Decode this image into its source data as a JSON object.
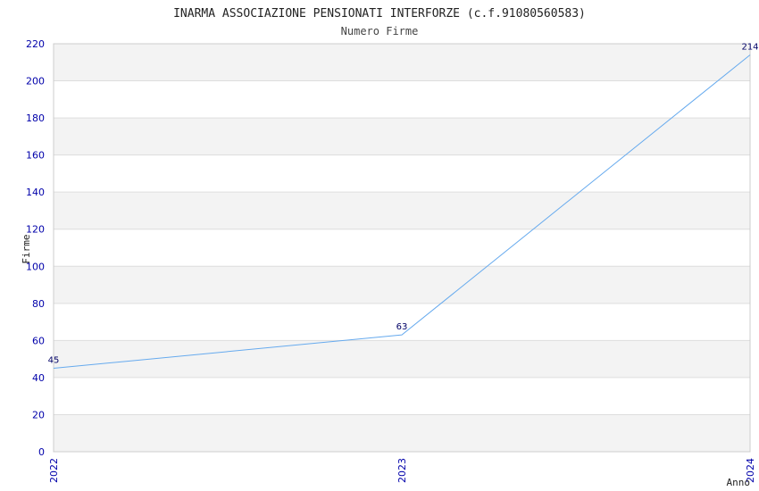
{
  "chart_data": {
    "type": "line",
    "title": "INARMA ASSOCIAZIONE PENSIONATI INTERFORZE (c.f.91080560583)",
    "subtitle": "Numero Firme",
    "xlabel": "Anno",
    "ylabel": "Firme",
    "categories": [
      "2022",
      "2023",
      "2024"
    ],
    "series": [
      {
        "values": [
          45,
          63,
          214
        ]
      }
    ],
    "data_labels": [
      "45",
      "63",
      "214"
    ],
    "ylim": [
      0,
      220
    ],
    "yticks": [
      0,
      20,
      40,
      60,
      80,
      100,
      120,
      140,
      160,
      180,
      200,
      220
    ],
    "grid": true,
    "banded_background": true,
    "colors": {
      "line": "#66aaee",
      "tick_text": "#0000aa",
      "band": "#f3f3f3",
      "grid": "#dddddd",
      "data_label": "#000066"
    }
  }
}
